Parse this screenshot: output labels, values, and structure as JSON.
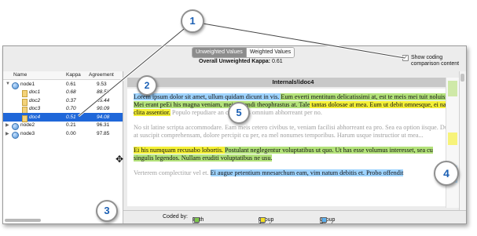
{
  "toolbar": {
    "tab_unweighted": "Unweighted Values",
    "tab_weighted": "Weighted Values",
    "kappa_label": "Overall Unweighted Kappa:",
    "kappa_value": "0.61"
  },
  "show_option": {
    "line1": "Show coding",
    "line2": "comparison content",
    "checked": true
  },
  "tree": {
    "headers": {
      "name": "Name",
      "kappa": "Kappa",
      "agreement": "Agreement"
    },
    "rows": [
      {
        "name": "node1",
        "kappa": "0.61",
        "agreement": "9.53",
        "kind": "node",
        "expanded": true
      },
      {
        "name": "doc1",
        "kappa": "0.68",
        "agreement": "88.50",
        "kind": "doc"
      },
      {
        "name": "doc2",
        "kappa": "0.37",
        "agreement": "65.44",
        "kind": "doc"
      },
      {
        "name": "doc3",
        "kappa": "0.70",
        "agreement": "90.09",
        "kind": "doc"
      },
      {
        "name": "doc4",
        "kappa": "0.51",
        "agreement": "94.08",
        "kind": "doc",
        "selected": true
      },
      {
        "name": "node2",
        "kappa": "0.21",
        "agreement": "96.31",
        "kind": "node"
      },
      {
        "name": "node3",
        "kappa": "0.00",
        "agreement": "97.85",
        "kind": "node"
      }
    ]
  },
  "document": {
    "title": "Internals\\\\doc4",
    "p1_a": "Lorem ipsum dolor sit amet, ullum quidam dicunt in vis. ",
    "p1_b": "Eum everti mentitum delicatissimi at, est te meis",
    "p1_c": " mei tuit noluisse. Mei erant pe",
    "p1_d": "Ei his magna veniam, mei eligendi theophrastus at. Tale",
    "p1_e": " tantas ",
    "p1_f": "dolosae at mea. Eum ut debi",
    "p1_g": "t omnesque, ei nam clita assentior.",
    "p1_h": " Populo repudiare an cum, quis omnium abhorreant per no.",
    "p2": "No sit latine scripta accommodare. Eam meis cetero civibus te, veniam facilisi abhorreant ea pro. Sea ea option iisque. Duo at suscipit comprehensam, dolore percipit cu per, ea mel nonumes temporibus. Harum usque instructior ut mea...",
    "p3_a": "Ei his numquam recusabo lobortis. ",
    "p3_b": "Postulant neglegentur voluptatibus ut quo. Ut has esse volumus interesset, sea cu singulis legendos. Nullam eruditi voluptatibus ne usu.",
    "p4_a": "Verterem complectitur vel et. ",
    "p4_b": "Ei augue petentium mnesarchum eam, vim natum debitis et. Probo offendit"
  },
  "legend": {
    "label": "Coded by:",
    "both": "Both groups",
    "a": "Group A only",
    "b": "Group B only",
    "both_color": "#7cc84a",
    "a_color": "#f4e020",
    "b_color": "#5ab0f0"
  },
  "callouts": [
    "1",
    "2",
    "3",
    "4",
    "5"
  ]
}
